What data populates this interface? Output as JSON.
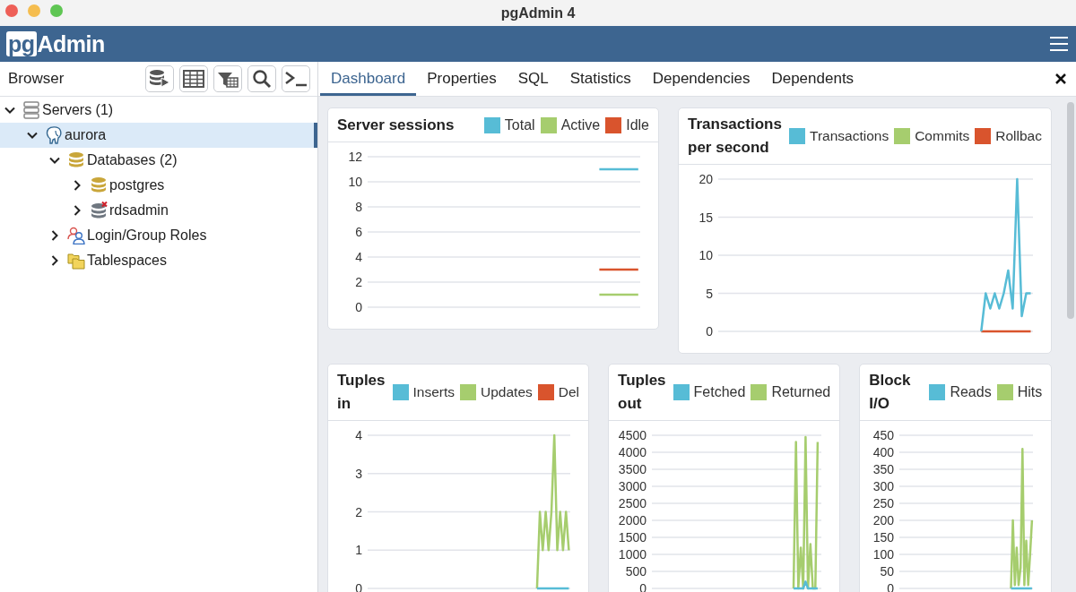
{
  "window": {
    "title": "pgAdmin 4"
  },
  "app_bar": {
    "logo_prefix": "pg",
    "logo_name": "Admin"
  },
  "browser": {
    "title": "Browser",
    "tree": [
      {
        "label": "Servers (1)",
        "kind": "servers",
        "expanded": true,
        "selected": false,
        "children": [
          {
            "label": "aurora",
            "kind": "server",
            "expanded": true,
            "selected": true,
            "children": [
              {
                "label": "Databases (2)",
                "kind": "databases",
                "expanded": true,
                "selected": false,
                "children": [
                  {
                    "label": "postgres",
                    "kind": "database",
                    "expanded": false,
                    "selected": false
                  },
                  {
                    "label": "rdsadmin",
                    "kind": "database_disconnected",
                    "expanded": false,
                    "selected": false
                  }
                ]
              },
              {
                "label": "Login/Group Roles",
                "kind": "roles",
                "expanded": false,
                "selected": false
              },
              {
                "label": "Tablespaces",
                "kind": "tablespaces",
                "expanded": false,
                "selected": false
              }
            ]
          }
        ]
      }
    ]
  },
  "tabs": [
    {
      "label": "Dashboard",
      "selected": true
    },
    {
      "label": "Properties",
      "selected": false
    },
    {
      "label": "SQL",
      "selected": false
    },
    {
      "label": "Statistics",
      "selected": false
    },
    {
      "label": "Dependencies",
      "selected": false
    },
    {
      "label": "Dependents",
      "selected": false
    }
  ],
  "dashboard": {
    "charts": [
      {
        "chart_data": {
          "type": "line",
          "title": "Server sessions",
          "grid": true,
          "ylim": [
            0,
            12
          ],
          "yticks": [
            0,
            2,
            4,
            6,
            8,
            10,
            12
          ],
          "categories": [
            null,
            null,
            null,
            null,
            null,
            null,
            null,
            null,
            null,
            null,
            null,
            null,
            null,
            null,
            null,
            null,
            null,
            null,
            null,
            null,
            null,
            null,
            null,
            null,
            null,
            null,
            null,
            null,
            null,
            null,
            null,
            null,
            null,
            null,
            null,
            null,
            null,
            null,
            null,
            null,
            null,
            null,
            null,
            null,
            null,
            null,
            null,
            null,
            null,
            null,
            null,
            null,
            null,
            null,
            null,
            null,
            null,
            null,
            null,
            null,
            null,
            null,
            null,
            null,
            null,
            null,
            null,
            null,
            null,
            null
          ],
          "series": [
            {
              "name": "Total",
              "color": "#57bcd6",
              "values": [
                null,
                null,
                null,
                null,
                null,
                null,
                null,
                null,
                null,
                null,
                null,
                null,
                null,
                null,
                null,
                null,
                null,
                null,
                null,
                null,
                null,
                null,
                null,
                null,
                null,
                null,
                null,
                null,
                null,
                null,
                null,
                null,
                null,
                null,
                null,
                null,
                null,
                null,
                null,
                null,
                null,
                null,
                null,
                null,
                null,
                null,
                null,
                null,
                null,
                null,
                null,
                null,
                null,
                null,
                null,
                null,
                null,
                null,
                null,
                11,
                11,
                11,
                11,
                11,
                11,
                11,
                11,
                11,
                11,
                11
              ]
            },
            {
              "name": "Active",
              "color": "#a6cd6e",
              "values": [
                null,
                null,
                null,
                null,
                null,
                null,
                null,
                null,
                null,
                null,
                null,
                null,
                null,
                null,
                null,
                null,
                null,
                null,
                null,
                null,
                null,
                null,
                null,
                null,
                null,
                null,
                null,
                null,
                null,
                null,
                null,
                null,
                null,
                null,
                null,
                null,
                null,
                null,
                null,
                null,
                null,
                null,
                null,
                null,
                null,
                null,
                null,
                null,
                null,
                null,
                null,
                null,
                null,
                null,
                null,
                null,
                null,
                null,
                null,
                1,
                1,
                1,
                1,
                1,
                1,
                1,
                1,
                1,
                1,
                1
              ]
            },
            {
              "name": "Idle",
              "color": "#d9542d",
              "values": [
                null,
                null,
                null,
                null,
                null,
                null,
                null,
                null,
                null,
                null,
                null,
                null,
                null,
                null,
                null,
                null,
                null,
                null,
                null,
                null,
                null,
                null,
                null,
                null,
                null,
                null,
                null,
                null,
                null,
                null,
                null,
                null,
                null,
                null,
                null,
                null,
                null,
                null,
                null,
                null,
                null,
                null,
                null,
                null,
                null,
                null,
                null,
                null,
                null,
                null,
                null,
                null,
                null,
                null,
                null,
                null,
                null,
                null,
                null,
                3,
                3,
                3,
                3,
                3,
                3,
                3,
                3,
                3,
                3,
                3
              ]
            }
          ]
        }
      },
      {
        "chart_data": {
          "type": "line",
          "title": "Transactions per second",
          "grid": true,
          "ylim": [
            0,
            20
          ],
          "yticks": [
            0,
            5,
            10,
            15,
            20
          ],
          "categories": [
            null,
            null,
            null,
            null,
            null,
            null,
            null,
            null,
            null,
            null,
            null,
            null,
            null,
            null,
            null,
            null,
            null,
            null,
            null,
            null,
            null,
            null,
            null,
            null,
            null,
            null,
            null,
            null,
            null,
            null,
            null,
            null,
            null,
            null,
            null,
            null,
            null,
            null,
            null,
            null,
            null,
            null,
            null,
            null,
            null,
            null,
            null,
            null,
            null,
            null,
            null,
            null,
            null,
            null,
            null,
            null,
            null,
            null,
            null,
            null,
            null,
            null,
            null,
            null,
            null,
            null,
            null,
            null,
            null,
            null
          ],
          "series": [
            {
              "name": "Transactions",
              "color": "#57bcd6",
              "values": [
                null,
                null,
                null,
                null,
                null,
                null,
                null,
                null,
                null,
                null,
                null,
                null,
                null,
                null,
                null,
                null,
                null,
                null,
                null,
                null,
                null,
                null,
                null,
                null,
                null,
                null,
                null,
                null,
                null,
                null,
                null,
                null,
                null,
                null,
                null,
                null,
                null,
                null,
                null,
                null,
                null,
                null,
                null,
                null,
                null,
                null,
                null,
                null,
                null,
                null,
                null,
                null,
                null,
                null,
                null,
                null,
                null,
                null,
                0,
                5,
                3,
                5,
                3,
                5,
                8,
                3,
                20,
                2,
                5,
                5
              ]
            },
            {
              "name": "Commits",
              "color": "#a6cd6e",
              "values": [
                null,
                null,
                null,
                null,
                null,
                null,
                null,
                null,
                null,
                null,
                null,
                null,
                null,
                null,
                null,
                null,
                null,
                null,
                null,
                null,
                null,
                null,
                null,
                null,
                null,
                null,
                null,
                null,
                null,
                null,
                null,
                null,
                null,
                null,
                null,
                null,
                null,
                null,
                null,
                null,
                null,
                null,
                null,
                null,
                null,
                null,
                null,
                null,
                null,
                null,
                null,
                null,
                null,
                null,
                null,
                null,
                null,
                null,
                null,
                null,
                null,
                null,
                null,
                null,
                null,
                null,
                null,
                null,
                null,
                null
              ]
            },
            {
              "name": "Rollbac",
              "color": "#d9542d",
              "values": [
                null,
                null,
                null,
                null,
                null,
                null,
                null,
                null,
                null,
                null,
                null,
                null,
                null,
                null,
                null,
                null,
                null,
                null,
                null,
                null,
                null,
                null,
                null,
                null,
                null,
                null,
                null,
                null,
                null,
                null,
                null,
                null,
                null,
                null,
                null,
                null,
                null,
                null,
                null,
                null,
                null,
                null,
                null,
                null,
                null,
                null,
                null,
                null,
                null,
                null,
                null,
                null,
                null,
                null,
                null,
                null,
                null,
                null,
                0,
                0,
                0,
                0,
                0,
                0,
                0,
                0,
                0,
                0,
                0,
                0
              ]
            }
          ]
        }
      },
      {
        "chart_data": {
          "type": "line",
          "title": "Tuples in",
          "grid": true,
          "ylim": [
            0,
            4
          ],
          "yticks": [
            0,
            1,
            2,
            3,
            4
          ],
          "categories": [
            null,
            null,
            null,
            null,
            null,
            null,
            null,
            null,
            null,
            null,
            null,
            null,
            null,
            null,
            null,
            null,
            null,
            null,
            null,
            null,
            null,
            null,
            null,
            null,
            null,
            null,
            null,
            null,
            null,
            null,
            null,
            null,
            null,
            null,
            null,
            null,
            null,
            null,
            null,
            null,
            null,
            null,
            null,
            null,
            null,
            null,
            null,
            null,
            null,
            null,
            null,
            null,
            null,
            null,
            null,
            null,
            null,
            null,
            null,
            null,
            null,
            null,
            null,
            null,
            null,
            null,
            null,
            null,
            null,
            null
          ],
          "series": [
            {
              "name": "Inserts",
              "color": "#57bcd6",
              "values": [
                null,
                null,
                null,
                null,
                null,
                null,
                null,
                null,
                null,
                null,
                null,
                null,
                null,
                null,
                null,
                null,
                null,
                null,
                null,
                null,
                null,
                null,
                null,
                null,
                null,
                null,
                null,
                null,
                null,
                null,
                null,
                null,
                null,
                null,
                null,
                null,
                null,
                null,
                null,
                null,
                null,
                null,
                null,
                null,
                null,
                null,
                null,
                null,
                null,
                null,
                null,
                null,
                null,
                null,
                null,
                null,
                null,
                null,
                0,
                0,
                0,
                0,
                0,
                0,
                0,
                0,
                0,
                0,
                0,
                0
              ]
            },
            {
              "name": "Updates",
              "color": "#a6cd6e",
              "values": [
                null,
                null,
                null,
                null,
                null,
                null,
                null,
                null,
                null,
                null,
                null,
                null,
                null,
                null,
                null,
                null,
                null,
                null,
                null,
                null,
                null,
                null,
                null,
                null,
                null,
                null,
                null,
                null,
                null,
                null,
                null,
                null,
                null,
                null,
                null,
                null,
                null,
                null,
                null,
                null,
                null,
                null,
                null,
                null,
                null,
                null,
                null,
                null,
                null,
                null,
                null,
                null,
                null,
                null,
                null,
                null,
                null,
                null,
                0,
                2,
                1,
                2,
                1,
                2,
                4,
                1,
                2,
                1,
                2,
                1
              ]
            },
            {
              "name": "Del",
              "color": "#d9542d",
              "values": [
                null,
                null,
                null,
                null,
                null,
                null,
                null,
                null,
                null,
                null,
                null,
                null,
                null,
                null,
                null,
                null,
                null,
                null,
                null,
                null,
                null,
                null,
                null,
                null,
                null,
                null,
                null,
                null,
                null,
                null,
                null,
                null,
                null,
                null,
                null,
                null,
                null,
                null,
                null,
                null,
                null,
                null,
                null,
                null,
                null,
                null,
                null,
                null,
                null,
                null,
                null,
                null,
                null,
                null,
                null,
                null,
                null,
                null,
                null,
                null,
                null,
                null,
                null,
                null,
                null,
                null,
                null,
                null,
                null,
                null
              ]
            }
          ]
        }
      },
      {
        "chart_data": {
          "type": "line",
          "title": "Tuples out",
          "grid": true,
          "ylim": [
            0,
            4500
          ],
          "yticks": [
            0,
            500,
            1000,
            1500,
            2000,
            2500,
            3000,
            3500,
            4000,
            4500
          ],
          "categories": [
            null,
            null,
            null,
            null,
            null,
            null,
            null,
            null,
            null,
            null,
            null,
            null,
            null,
            null,
            null,
            null,
            null,
            null,
            null,
            null,
            null,
            null,
            null,
            null,
            null,
            null,
            null,
            null,
            null,
            null,
            null,
            null,
            null,
            null,
            null,
            null,
            null,
            null,
            null,
            null,
            null,
            null,
            null,
            null,
            null,
            null,
            null,
            null,
            null,
            null,
            null,
            null,
            null,
            null,
            null,
            null,
            null,
            null,
            null,
            null,
            null,
            null,
            null,
            null,
            null,
            null,
            null,
            null,
            null,
            null
          ],
          "series": [
            {
              "name": "Fetched",
              "color": "#57bcd6",
              "values": [
                null,
                null,
                null,
                null,
                null,
                null,
                null,
                null,
                null,
                null,
                null,
                null,
                null,
                null,
                null,
                null,
                null,
                null,
                null,
                null,
                null,
                null,
                null,
                null,
                null,
                null,
                null,
                null,
                null,
                null,
                null,
                null,
                null,
                null,
                null,
                null,
                null,
                null,
                null,
                null,
                null,
                null,
                null,
                null,
                null,
                null,
                null,
                null,
                null,
                null,
                null,
                null,
                null,
                null,
                null,
                null,
                null,
                null,
                0,
                0,
                0,
                0,
                0,
                200,
                0,
                0,
                0,
                0,
                0,
                null
              ]
            },
            {
              "name": "Returned",
              "color": "#a6cd6e",
              "values": [
                null,
                null,
                null,
                null,
                null,
                null,
                null,
                null,
                null,
                null,
                null,
                null,
                null,
                null,
                null,
                null,
                null,
                null,
                null,
                null,
                null,
                null,
                null,
                null,
                null,
                null,
                null,
                null,
                null,
                null,
                null,
                null,
                null,
                null,
                null,
                null,
                null,
                null,
                null,
                null,
                null,
                null,
                null,
                null,
                null,
                null,
                null,
                null,
                null,
                null,
                null,
                null,
                null,
                null,
                null,
                null,
                null,
                null,
                0,
                4300,
                0,
                1200,
                0,
                4450,
                0,
                1300,
                0,
                0,
                4300,
                null
              ]
            }
          ]
        }
      },
      {
        "chart_data": {
          "type": "line",
          "title": "Block I/O",
          "grid": true,
          "ylim": [
            0,
            450
          ],
          "yticks": [
            0,
            50,
            100,
            150,
            200,
            250,
            300,
            350,
            400,
            450
          ],
          "categories": [
            null,
            null,
            null,
            null,
            null,
            null,
            null,
            null,
            null,
            null,
            null,
            null,
            null,
            null,
            null,
            null,
            null,
            null,
            null,
            null,
            null,
            null,
            null,
            null,
            null,
            null,
            null,
            null,
            null,
            null,
            null,
            null,
            null,
            null,
            null,
            null,
            null,
            null,
            null,
            null,
            null,
            null,
            null,
            null,
            null,
            null,
            null,
            null,
            null,
            null,
            null,
            null,
            null,
            null,
            null,
            null,
            null,
            null,
            null,
            null,
            null,
            null,
            null,
            null,
            null,
            null,
            null,
            null,
            null,
            null
          ],
          "series": [
            {
              "name": "Reads",
              "color": "#57bcd6",
              "values": [
                null,
                null,
                null,
                null,
                null,
                null,
                null,
                null,
                null,
                null,
                null,
                null,
                null,
                null,
                null,
                null,
                null,
                null,
                null,
                null,
                null,
                null,
                null,
                null,
                null,
                null,
                null,
                null,
                null,
                null,
                null,
                null,
                null,
                null,
                null,
                null,
                null,
                null,
                null,
                null,
                null,
                null,
                null,
                null,
                null,
                null,
                null,
                null,
                null,
                null,
                null,
                null,
                null,
                null,
                null,
                null,
                null,
                null,
                0,
                0,
                0,
                0,
                0,
                0,
                0,
                0,
                0,
                0,
                0,
                0
              ]
            },
            {
              "name": "Hits",
              "color": "#a6cd6e",
              "values": [
                null,
                null,
                null,
                null,
                null,
                null,
                null,
                null,
                null,
                null,
                null,
                null,
                null,
                null,
                null,
                null,
                null,
                null,
                null,
                null,
                null,
                null,
                null,
                null,
                null,
                null,
                null,
                null,
                null,
                null,
                null,
                null,
                null,
                null,
                null,
                null,
                null,
                null,
                null,
                null,
                null,
                null,
                null,
                null,
                null,
                null,
                null,
                null,
                null,
                null,
                null,
                null,
                null,
                null,
                null,
                null,
                null,
                null,
                0,
                200,
                10,
                120,
                10,
                60,
                410,
                10,
                140,
                10,
                100,
                200
              ]
            }
          ]
        }
      }
    ]
  }
}
